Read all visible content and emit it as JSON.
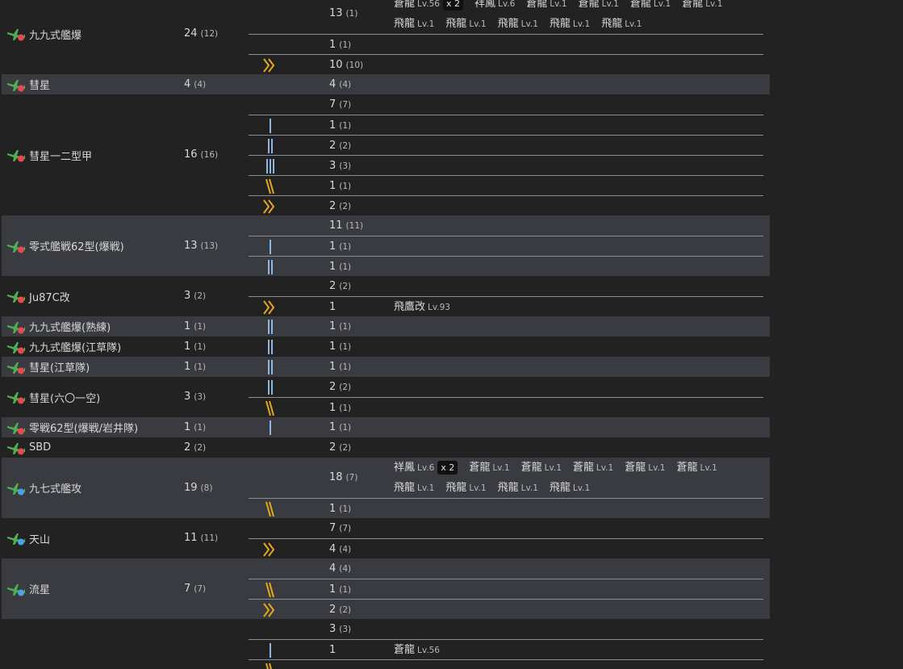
{
  "equipment": [
    {
      "name": "九九式艦爆",
      "total": "24",
      "sub": "(12)",
      "icon": "bomber-red-icon",
      "alt": false,
      "rows": [
        {
          "prof": "",
          "count": "13",
          "sub": "(1)",
          "h": 2,
          "ships": [
            {
              "name": "蒼龍",
              "lv": "Lv.56",
              "mult": "x 2"
            },
            {
              "name": "祥鳳",
              "lv": "Lv.6"
            },
            {
              "name": "蒼龍",
              "lv": "Lv.1"
            },
            {
              "name": "蒼龍",
              "lv": "Lv.1"
            },
            {
              "name": "蒼龍",
              "lv": "Lv.1"
            },
            {
              "name": "蒼龍",
              "lv": "Lv.1"
            },
            {
              "name": "飛龍",
              "lv": "Lv.1"
            },
            {
              "name": "飛龍",
              "lv": "Lv.1"
            },
            {
              "name": "飛龍",
              "lv": "Lv.1"
            },
            {
              "name": "飛龍",
              "lv": "Lv.1"
            },
            {
              "name": "飛龍",
              "lv": "Lv.1"
            }
          ]
        },
        {
          "prof": "1",
          "count": "1",
          "sub": "(1)",
          "h": 1,
          "ships": []
        },
        {
          "prof": ">>",
          "count": "10",
          "sub": "(10)",
          "h": 1,
          "ships": []
        }
      ]
    },
    {
      "name": "彗星",
      "total": "4",
      "sub": "(4)",
      "icon": "bomber-red-icon",
      "alt": true,
      "rows": [
        {
          "prof": "",
          "count": "4",
          "sub": "(4)",
          "h": 1,
          "ships": []
        }
      ]
    },
    {
      "name": "彗星一二型甲",
      "total": "16",
      "sub": "(16)",
      "icon": "bomber-red-icon",
      "alt": false,
      "rows": [
        {
          "prof": "",
          "count": "7",
          "sub": "(7)",
          "h": 1,
          "ships": []
        },
        {
          "prof": "|",
          "count": "1",
          "sub": "(1)",
          "h": 1,
          "ships": []
        },
        {
          "prof": "||",
          "count": "2",
          "sub": "(2)",
          "h": 1,
          "ships": []
        },
        {
          "prof": "|||",
          "count": "3",
          "sub": "(3)",
          "h": 1,
          "ships": []
        },
        {
          "prof": "\\\\",
          "count": "1",
          "sub": "(1)",
          "h": 1,
          "ships": []
        },
        {
          "prof": ">>",
          "count": "2",
          "sub": "(2)",
          "h": 1,
          "ships": []
        }
      ]
    },
    {
      "name": "零式艦戦62型(爆戦)",
      "total": "13",
      "sub": "(13)",
      "icon": "bomber-red-icon",
      "alt": true,
      "rows": [
        {
          "prof": "",
          "count": "11",
          "sub": "(11)",
          "h": 1,
          "ships": []
        },
        {
          "prof": "|",
          "count": "1",
          "sub": "(1)",
          "h": 1,
          "ships": []
        },
        {
          "prof": "||",
          "count": "1",
          "sub": "(1)",
          "h": 1,
          "ships": []
        }
      ]
    },
    {
      "name": "Ju87C改",
      "total": "3",
      "sub": "(2)",
      "icon": "bomber-red-icon",
      "alt": false,
      "rows": [
        {
          "prof": "",
          "count": "2",
          "sub": "(2)",
          "h": 1,
          "ships": []
        },
        {
          "prof": ">>",
          "count": "1",
          "sub": "",
          "h": 1,
          "ships": [
            {
              "name": "飛鷹改",
              "lv": "Lv.93"
            }
          ]
        }
      ]
    },
    {
      "name": "九九式艦爆(熟練)",
      "total": "1",
      "sub": "(1)",
      "icon": "bomber-red-icon",
      "alt": true,
      "rows": [
        {
          "prof": "||",
          "count": "1",
          "sub": "(1)",
          "h": 1,
          "ships": []
        }
      ]
    },
    {
      "name": "九九式艦爆(江草隊)",
      "total": "1",
      "sub": "(1)",
      "icon": "bomber-red-icon",
      "alt": false,
      "rows": [
        {
          "prof": "||",
          "count": "1",
          "sub": "(1)",
          "h": 1,
          "ships": []
        }
      ]
    },
    {
      "name": "彗星(江草隊)",
      "total": "1",
      "sub": "(1)",
      "icon": "bomber-red-icon",
      "alt": true,
      "rows": [
        {
          "prof": "||",
          "count": "1",
          "sub": "(1)",
          "h": 1,
          "ships": []
        }
      ]
    },
    {
      "name": "彗星(六〇一空)",
      "total": "3",
      "sub": "(3)",
      "icon": "bomber-red-icon",
      "alt": false,
      "rows": [
        {
          "prof": "||",
          "count": "2",
          "sub": "(2)",
          "h": 1,
          "ships": []
        },
        {
          "prof": "\\\\",
          "count": "1",
          "sub": "(1)",
          "h": 1,
          "ships": []
        }
      ]
    },
    {
      "name": "零戦62型(爆戦/岩井隊)",
      "total": "1",
      "sub": "(1)",
      "icon": "bomber-red-icon",
      "alt": true,
      "rows": [
        {
          "prof": "|",
          "count": "1",
          "sub": "(1)",
          "h": 1,
          "ships": []
        }
      ]
    },
    {
      "name": "SBD",
      "total": "2",
      "sub": "(2)",
      "icon": "bomber-red-icon",
      "alt": false,
      "rows": [
        {
          "prof": "",
          "count": "2",
          "sub": "(2)",
          "h": 1,
          "ships": []
        }
      ]
    },
    {
      "name": "九七式艦攻",
      "total": "19",
      "sub": "(8)",
      "icon": "torpedo-blue-icon",
      "alt": true,
      "rows": [
        {
          "prof": "",
          "count": "18",
          "sub": "(7)",
          "h": 2,
          "ships": [
            {
              "name": "祥鳳",
              "lv": "Lv.6",
              "mult": "x 2"
            },
            {
              "name": "蒼龍",
              "lv": "Lv.1"
            },
            {
              "name": "蒼龍",
              "lv": "Lv.1"
            },
            {
              "name": "蒼龍",
              "lv": "Lv.1"
            },
            {
              "name": "蒼龍",
              "lv": "Lv.1"
            },
            {
              "name": "蒼龍",
              "lv": "Lv.1"
            },
            {
              "name": "飛龍",
              "lv": "Lv.1"
            },
            {
              "name": "飛龍",
              "lv": "Lv.1"
            },
            {
              "name": "飛龍",
              "lv": "Lv.1"
            },
            {
              "name": "飛龍",
              "lv": "Lv.1"
            }
          ]
        },
        {
          "prof": "\\\\",
          "count": "1",
          "sub": "(1)",
          "h": 1,
          "ships": []
        }
      ]
    },
    {
      "name": "天山",
      "total": "11",
      "sub": "(11)",
      "icon": "torpedo-blue-icon",
      "alt": false,
      "rows": [
        {
          "prof": "",
          "count": "7",
          "sub": "(7)",
          "h": 1,
          "ships": []
        },
        {
          "prof": ">>",
          "count": "4",
          "sub": "(4)",
          "h": 1,
          "ships": []
        }
      ]
    },
    {
      "name": "流星",
      "total": "7",
      "sub": "(7)",
      "icon": "torpedo-blue-icon",
      "alt": true,
      "rows": [
        {
          "prof": "",
          "count": "4",
          "sub": "(4)",
          "h": 1,
          "ships": []
        },
        {
          "prof": "\\\\",
          "count": "1",
          "sub": "(1)",
          "h": 1,
          "ships": []
        },
        {
          "prof": ">>",
          "count": "2",
          "sub": "(2)",
          "h": 1,
          "ships": []
        }
      ]
    },
    {
      "name": "",
      "total": "",
      "sub": "",
      "icon": "",
      "alt": false,
      "rows": [
        {
          "prof": "",
          "count": "3",
          "sub": "(3)",
          "h": 1,
          "ships": []
        },
        {
          "prof": "|",
          "count": "1",
          "sub": "",
          "h": 1,
          "ships": [
            {
              "name": "蒼龍",
              "lv": "Lv.56"
            }
          ]
        },
        {
          "prof": "\\\\",
          "count": "",
          "sub": "",
          "h": 1,
          "ships": []
        }
      ]
    }
  ],
  "colors": {
    "background": "#222222",
    "stripe": "#393b41",
    "text": "#d8d8d8",
    "prof_low": "#8fb6de",
    "prof_high": "#e6a817",
    "bomber_dot": "#e44b4b",
    "torpedo_dot": "#4aa3e0",
    "plane": "#4fae54"
  }
}
